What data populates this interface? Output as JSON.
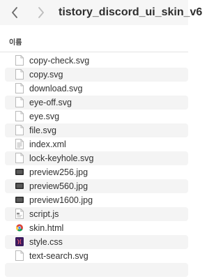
{
  "window": {
    "title": "tistory_discord_ui_skin_v6",
    "back_icon": "chevron-left-icon",
    "forward_icon": "chevron-right-icon"
  },
  "columns": {
    "name_header": "이름"
  },
  "files": [
    {
      "name": "copy-check.svg",
      "icon": "document-icon"
    },
    {
      "name": "copy.svg",
      "icon": "document-icon"
    },
    {
      "name": "download.svg",
      "icon": "document-icon"
    },
    {
      "name": "eye-off.svg",
      "icon": "document-icon"
    },
    {
      "name": "eye.svg",
      "icon": "document-icon"
    },
    {
      "name": "file.svg",
      "icon": "document-icon"
    },
    {
      "name": "index.xml",
      "icon": "text-document-icon"
    },
    {
      "name": "lock-keyhole.svg",
      "icon": "document-icon"
    },
    {
      "name": "preview256.jpg",
      "icon": "image-icon"
    },
    {
      "name": "preview560.jpg",
      "icon": "image-icon"
    },
    {
      "name": "preview1600.jpg",
      "icon": "image-icon"
    },
    {
      "name": "script.js",
      "icon": "script-file-icon"
    },
    {
      "name": "skin.html",
      "icon": "chrome-html-icon"
    },
    {
      "name": "style.css",
      "icon": "css-file-icon"
    },
    {
      "name": "text-search.svg",
      "icon": "document-icon"
    }
  ],
  "colors": {
    "toolbar_bg": "#f6f6f6",
    "row_alt_bg": "#f4f4f4",
    "text": "#303030"
  }
}
